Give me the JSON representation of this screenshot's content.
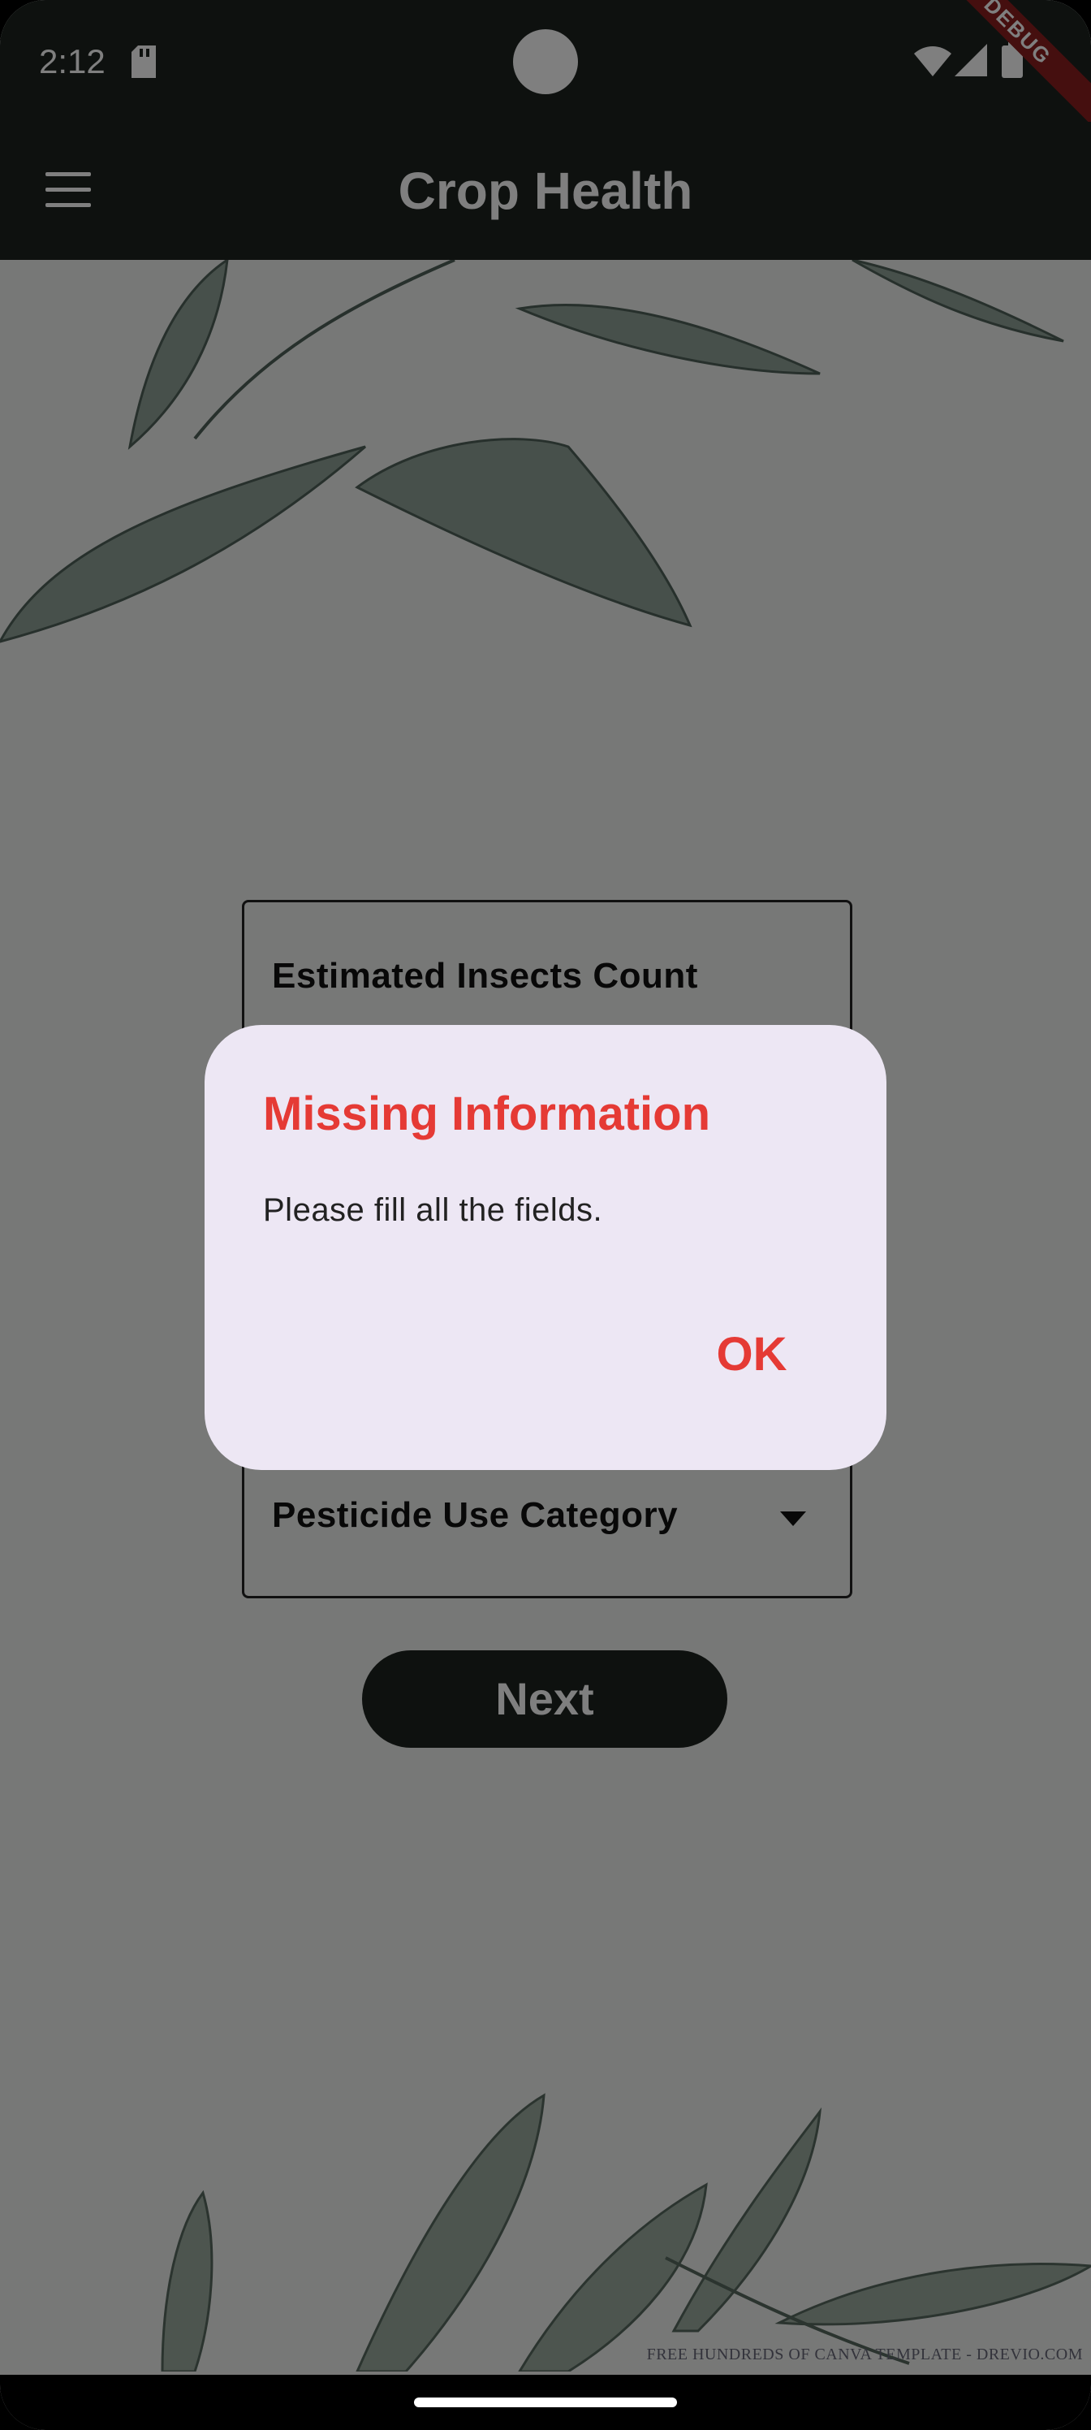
{
  "status_bar": {
    "time": "2:12",
    "debug_label": "DEBUG"
  },
  "app_bar": {
    "title": "Crop Health"
  },
  "form": {
    "insects_label": "Estimated Insects Count",
    "pesticide_label": "Pesticide Use Category",
    "next_label": "Next"
  },
  "dialog": {
    "title": "Missing Information",
    "message": "Please fill all the fields.",
    "ok_label": "OK"
  },
  "background": {
    "watermark": "FREE HUNDREDS OF CANVA TEMPLATE - DREVIO.COM"
  },
  "colors": {
    "app_bar": "#1c221f",
    "dialog_bg": "#ede7f4",
    "accent_red": "#e53a35"
  },
  "icons": [
    "sd-card-icon",
    "wifi-icon",
    "signal-icon",
    "battery-icon",
    "menu-icon",
    "dropdown-arrow-icon"
  ]
}
